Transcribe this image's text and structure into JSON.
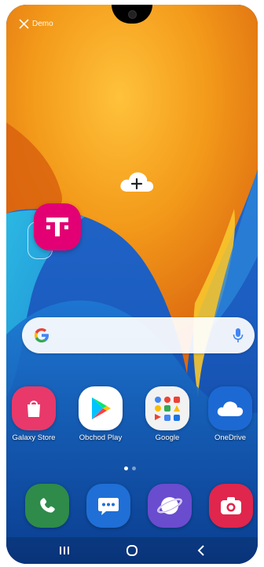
{
  "status": {
    "demo_label": "Demo"
  },
  "home": {
    "add_page_icon": "cloud-plus-icon",
    "tmobile_icon": "tmobile-logo-icon"
  },
  "search_bar": {
    "google_icon": "google-g-icon",
    "mic_icon": "microphone-icon"
  },
  "apps": [
    {
      "label": "Galaxy Store",
      "icon": "shopping-bag-icon",
      "color": "#e23a6d"
    },
    {
      "label": "Obchod Play",
      "icon": "play-store-icon",
      "color": "#ffffff"
    },
    {
      "label": "Google",
      "icon": "google-folder-icon",
      "color": "#f2f2f2"
    },
    {
      "label": "OneDrive",
      "icon": "cloud-icon",
      "color": "#1c69d4"
    }
  ],
  "dock": [
    {
      "icon": "phone-icon",
      "color": "#2e8b4a"
    },
    {
      "icon": "messages-icon",
      "color": "#1f6fd6"
    },
    {
      "icon": "internet-icon",
      "color": "#6a4ccf"
    },
    {
      "icon": "camera-icon",
      "color": "#e0264c"
    }
  ],
  "navbar": {
    "recents_icon": "recents-icon",
    "home_icon": "home-icon",
    "back_icon": "back-icon"
  },
  "page_indicator": {
    "count": 2,
    "active": 1
  },
  "colors": {
    "tmobile": "#e20074",
    "wallpaper_orange": "#f39a1a",
    "wallpaper_blue": "#1e63c8"
  }
}
